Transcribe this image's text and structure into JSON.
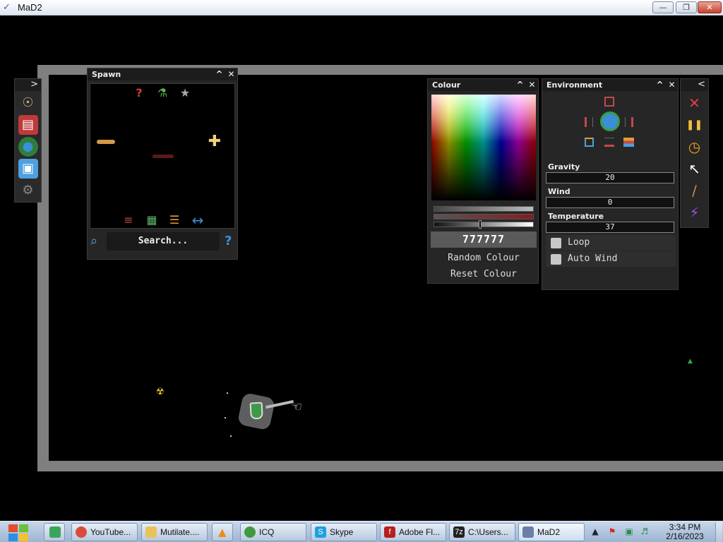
{
  "window": {
    "title": "MaD2",
    "minimize": "—",
    "maximize": "❐",
    "close": "✕",
    "app_icon": "mad2-app-icon"
  },
  "colors": {
    "world_border": "#7f7f7f",
    "panel_bg": "#262626",
    "panel_header": "#1c1c1c",
    "accent_blue": "#3a8fd6",
    "selected_colour": "#777777"
  },
  "left_toolbar": {
    "toggle": ">",
    "buttons": [
      {
        "name": "humanoid-icon",
        "glyph": "☉"
      },
      {
        "name": "book-icon",
        "glyph": "▤"
      },
      {
        "name": "globe-icon",
        "glyph": "●"
      },
      {
        "name": "save-icon",
        "glyph": "▣"
      },
      {
        "name": "gear-icon",
        "glyph": "⚙"
      }
    ]
  },
  "spawn_panel": {
    "title": "Spawn",
    "collapse": "^",
    "close": "✕",
    "top_icons": [
      {
        "name": "random-question-icon",
        "glyph": "?"
      },
      {
        "name": "flask-icon",
        "glyph": "⚗"
      },
      {
        "name": "star-icon",
        "glyph": "★"
      }
    ],
    "bottom_icons": [
      {
        "name": "sliders-icon",
        "glyph": "≡"
      },
      {
        "name": "grid-icon",
        "glyph": "▦"
      },
      {
        "name": "layers-icon",
        "glyph": "☰"
      },
      {
        "name": "swap-arrows-icon",
        "glyph": "↔"
      }
    ],
    "search_placeholder": "Search...",
    "search_icon": "⌕",
    "help": "?"
  },
  "colour_panel": {
    "title": "Colour",
    "collapse": "^",
    "close": "✕",
    "hex_value": "777777",
    "random_label": "Random Colour",
    "reset_label": "Reset Colour"
  },
  "environment_panel": {
    "title": "Environment",
    "collapse": "^",
    "close": "✕",
    "gravity_label": "Gravity",
    "gravity_value": "20",
    "wind_label": "Wind",
    "wind_value": "0",
    "temperature_label": "Temperature",
    "temperature_value": "37",
    "loop_label": "Loop",
    "auto_wind_label": "Auto Wind"
  },
  "right_toolbar": {
    "toggle": "<",
    "buttons": [
      {
        "name": "clear-x-icon",
        "glyph": "✕"
      },
      {
        "name": "pause-icon",
        "glyph": "❚❚"
      },
      {
        "name": "stopwatch-icon",
        "glyph": "◷"
      },
      {
        "name": "pointer-icon",
        "glyph": "↖"
      },
      {
        "name": "knife-icon",
        "glyph": "∕"
      },
      {
        "name": "lightning-icon",
        "glyph": "⚡"
      }
    ]
  },
  "taskbar": {
    "items": [
      {
        "label": "YouTube...",
        "icon": "chrome-icon"
      },
      {
        "label": "Mutilate....",
        "icon": "folder-icon"
      },
      {
        "label": "ICQ",
        "icon": "icq-icon"
      },
      {
        "label": "Skype",
        "icon": "skype-icon"
      },
      {
        "label": "Adobe Fl...",
        "icon": "flash-icon"
      },
      {
        "label": "C:\\Users...",
        "icon": "terminal-icon"
      },
      {
        "label": "MaD2",
        "icon": "mad2-icon"
      }
    ],
    "clock_time": "3:34 PM",
    "clock_date": "2/16/2023",
    "tray_up": "▲"
  }
}
